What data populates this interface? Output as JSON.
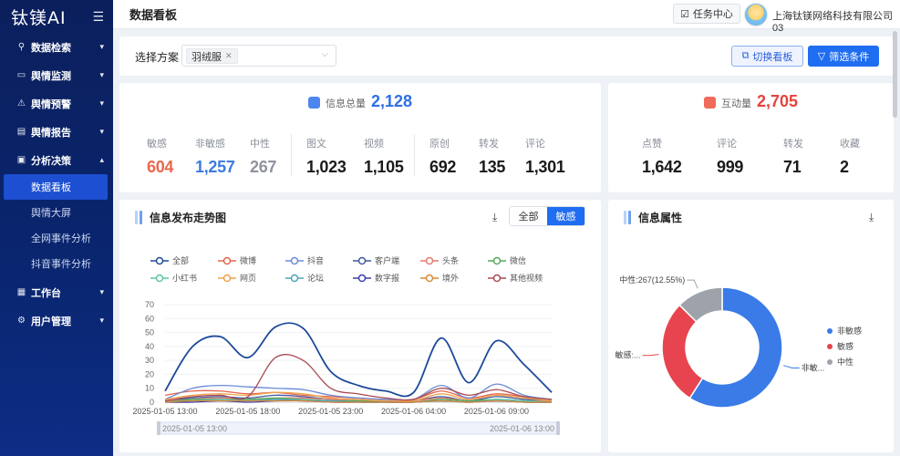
{
  "sidebar": {
    "brand": "钛镁AI",
    "menu": [
      {
        "label": "数据检索",
        "icon": "search-icon",
        "chevron": "▾"
      },
      {
        "label": "舆情监测",
        "icon": "monitor-icon",
        "chevron": "▾"
      },
      {
        "label": "舆情预警",
        "icon": "warning-icon",
        "chevron": "▾"
      },
      {
        "label": "舆情报告",
        "icon": "report-icon",
        "chevron": "▾"
      },
      {
        "label": "分析决策",
        "icon": "analysis-icon",
        "chevron": "▴"
      }
    ],
    "submenu": [
      "数据看板",
      "舆情大屏",
      "全网事件分析",
      "抖音事件分析"
    ],
    "menu_bottom": [
      {
        "label": "工作台",
        "icon": "workbench-icon",
        "chevron": "▾"
      },
      {
        "label": "用户管理",
        "icon": "user-gear-icon",
        "chevron": "▾"
      }
    ]
  },
  "header": {
    "title": "数据看板",
    "task_center": "任务中心",
    "company": "上海钛镁网络科技有限公司03"
  },
  "plan": {
    "label": "选择方案",
    "selected_tag": "羽绒服",
    "switch_button": "切换看板",
    "filter_button": "筛选条件"
  },
  "summary": {
    "info_total_label": "信息总量",
    "info_total_value": "2,128",
    "items": [
      {
        "label": "敏感",
        "value": "604",
        "color": "#e9684f"
      },
      {
        "label": "非敏感",
        "value": "1,257",
        "color": "#3d7be0"
      },
      {
        "label": "中性",
        "value": "267",
        "color": "#8f939c"
      },
      {
        "label": "图文",
        "value": "1,023",
        "color": "#1a1a1a"
      },
      {
        "label": "视频",
        "value": "1,105",
        "color": "#1a1a1a"
      },
      {
        "label": "原创",
        "value": "692",
        "color": "#1a1a1a"
      },
      {
        "label": "转发",
        "value": "135",
        "color": "#1a1a1a"
      },
      {
        "label": "评论",
        "value": "1,301",
        "color": "#1a1a1a"
      }
    ],
    "interaction_label": "互动量",
    "interaction_value": "2,705",
    "interaction_items": [
      {
        "label": "点赞",
        "value": "1,642"
      },
      {
        "label": "评论",
        "value": "999"
      },
      {
        "label": "转发",
        "value": "71"
      },
      {
        "label": "收藏",
        "value": "2"
      }
    ]
  },
  "trend_panel": {
    "title": "信息发布走势图",
    "toggle_all": "全部",
    "toggle_sensitive": "敏感"
  },
  "attr_panel": {
    "title": "信息属性"
  },
  "chart_data": [
    {
      "type": "line",
      "x": [
        "2025-01-05 13:00",
        "2025-01-05 15:00",
        "2025-01-05 17:00",
        "2025-01-05 18:00",
        "2025-01-05 19:00",
        "2025-01-05 21:00",
        "2025-01-05 23:00",
        "2025-01-06 01:00",
        "2025-01-06 03:00",
        "2025-01-06 04:00",
        "2025-01-06 05:00",
        "2025-01-06 07:00",
        "2025-01-06 09:00",
        "2025-01-06 11:00",
        "2025-01-06 13:00"
      ],
      "x_tick_labels": [
        "2025-01-05 13:00",
        "2025-01-05 18:00",
        "2025-01-05 23:00",
        "2025-01-06 04:00",
        "2025-01-06 09:00"
      ],
      "zoom_labels": [
        "2025-01-05 13:00",
        "2025-01-06 13:00"
      ],
      "ylim": [
        0,
        70
      ],
      "yticks": [
        0,
        10,
        20,
        30,
        40,
        50,
        60,
        70
      ],
      "legend_rows": [
        [
          "全部",
          "微博",
          "抖音",
          "客户端",
          "头条",
          "微信"
        ],
        [
          "小红书",
          "网页",
          "论坛",
          "数字报",
          "境外",
          "其他视频"
        ]
      ],
      "series": [
        {
          "name": "全部",
          "color": "#1e4a9a",
          "values": [
            8,
            40,
            47,
            32,
            54,
            53,
            22,
            12,
            8,
            7,
            46,
            14,
            44,
            27,
            7
          ]
        },
        {
          "name": "微博",
          "color": "#e2664f",
          "values": [
            5,
            8,
            8,
            6,
            7,
            5,
            4,
            3,
            2,
            2,
            8,
            3,
            6,
            4,
            2
          ]
        },
        {
          "name": "抖音",
          "color": "#6b8bd6",
          "values": [
            2,
            10,
            12,
            11,
            10,
            9,
            5,
            3,
            2,
            2,
            12,
            3,
            13,
            5,
            2
          ]
        },
        {
          "name": "客户端",
          "color": "#3f5a9d",
          "values": [
            1,
            3,
            4,
            3,
            5,
            4,
            2,
            1,
            1,
            1,
            4,
            1,
            4,
            2,
            1
          ]
        },
        {
          "name": "头条",
          "color": "#e27a6d",
          "values": [
            1,
            2,
            3,
            2,
            3,
            3,
            2,
            1,
            1,
            1,
            3,
            1,
            2,
            1,
            1
          ]
        },
        {
          "name": "微信",
          "color": "#57a95c",
          "values": [
            0,
            2,
            2,
            2,
            3,
            2,
            1,
            1,
            0,
            0,
            2,
            1,
            2,
            1,
            0
          ]
        },
        {
          "name": "小红书",
          "color": "#5fc4a6",
          "values": [
            0,
            1,
            2,
            1,
            2,
            2,
            1,
            0,
            0,
            0,
            1,
            0,
            2,
            1,
            0
          ]
        },
        {
          "name": "网页",
          "color": "#f0a24a",
          "values": [
            2,
            5,
            6,
            5,
            7,
            6,
            3,
            2,
            1,
            1,
            6,
            2,
            5,
            3,
            1
          ]
        },
        {
          "name": "论坛",
          "color": "#4fa3b5",
          "values": [
            0,
            1,
            1,
            1,
            2,
            1,
            1,
            0,
            0,
            0,
            1,
            0,
            1,
            0,
            0
          ]
        },
        {
          "name": "数字报",
          "color": "#3b3fa8",
          "values": [
            0,
            0,
            1,
            0,
            1,
            1,
            0,
            0,
            0,
            0,
            1,
            0,
            1,
            0,
            0
          ]
        },
        {
          "name": "境外",
          "color": "#d98a3a",
          "values": [
            0,
            1,
            1,
            1,
            1,
            1,
            0,
            0,
            0,
            0,
            1,
            0,
            1,
            0,
            0
          ]
        },
        {
          "name": "其他视频",
          "color": "#a84a55",
          "values": [
            1,
            4,
            5,
            4,
            32,
            30,
            10,
            6,
            3,
            2,
            10,
            5,
            9,
            4,
            2
          ]
        }
      ]
    },
    {
      "type": "pie",
      "labels": [
        "非敏感",
        "敏感",
        "中性"
      ],
      "values": [
        1257,
        604,
        267
      ],
      "colors": [
        "#3a7be8",
        "#e7444f",
        "#9ea3ab"
      ],
      "slice_labels": [
        "非敏...",
        "敏感:...",
        "中性:267(12.55%)"
      ]
    }
  ]
}
